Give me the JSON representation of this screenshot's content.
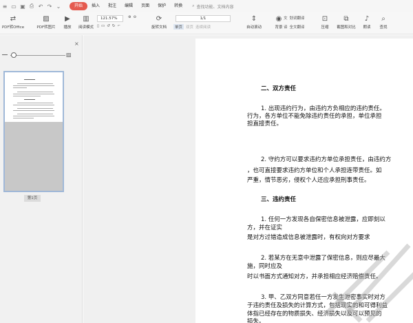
{
  "menu": {
    "items": [
      "开始",
      "插入",
      "批注",
      "编辑",
      "页面",
      "保护",
      "转换"
    ],
    "active": "开始",
    "search_placeholder": "查找功能、文档内容"
  },
  "toolbar": {
    "pdf_to_office": "PDF转Office",
    "pdf_to_image": "PDF转图片",
    "play": "播放",
    "read_mode": "阅读模式",
    "zoom": "121.57%",
    "page": "1/1",
    "rotate": "旋转文档",
    "single": "单页",
    "double": "双页",
    "continuous": "连续阅读",
    "auto_scroll": "自动滚动",
    "background": "背景",
    "translate": "划词翻译",
    "full_translate": "全文翻译",
    "compress": "压缩",
    "screen_recognize": "截图和对比",
    "read_aloud": "朗读",
    "find": "查找"
  },
  "sidebar": {
    "page_label": "第1页"
  },
  "document": {
    "h1": "二、双方责任",
    "p1": [
      "1. 出现违约行为，由违约方负相应的违约责任。",
      "行为，各方单位不能免除违约责任的承担，单位承担",
      "担直接责任。"
    ],
    "p2": [
      "2. 守约方可以要求违约方单位承担责任，由违约方",
      "，也可直接要求违约方单位和个人承担连带责任。如",
      "严重，情节恶劣，侵权个人还应承担刑事责任。"
    ],
    "h2": "三、违约责任",
    "p3": [
      "1. 任何一方发现各自保密信息被泄露，应即刻以",
      "方，并在证实",
      "是对方过错造成信息被泄露时，有权向对方要求"
    ],
    "p4": [
      "2. 若某方在无意中泄露了保密信息，则应尽最大",
      "施，同时应及",
      "时以书面方式通知对方，并承担相应经济赔偿责任。"
    ],
    "p5": [
      "3. 甲、乙双方同意若任一方发生泄密事实时对方",
      "于违约责任及损失的计算方式，包括现实的和可得利益",
      "体指已经存在的物质损失、经济损失以及可以预见的",
      "损失。"
    ]
  }
}
